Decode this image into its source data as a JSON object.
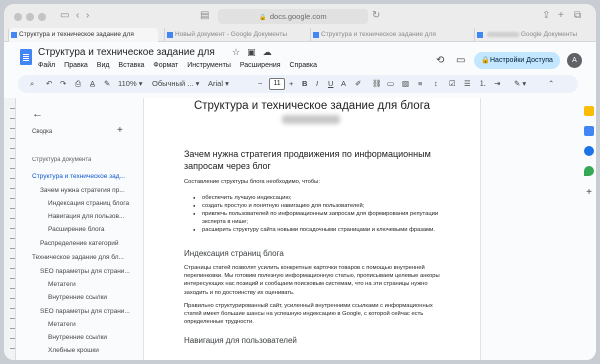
{
  "browser": {
    "address": "docs.google.com",
    "tabs": [
      {
        "label": "Структура и техническое задание для",
        "active": true
      },
      {
        "label": "Новый документ - Google Документы",
        "active": false
      },
      {
        "label": "Структура и техническое задание для",
        "active": false
      },
      {
        "label": "Google Документы",
        "active": false
      }
    ]
  },
  "doc": {
    "title": "Структура и техническое задание для",
    "menu": [
      "Файл",
      "Правка",
      "Вид",
      "Вставка",
      "Формат",
      "Инструменты",
      "Расширения",
      "Справка"
    ],
    "share_label": "Настройки Доступа",
    "avatar_letter": "A"
  },
  "toolbar": {
    "zoom": "110%",
    "style": "Обычный ...",
    "font": "Arial",
    "font_size": "11"
  },
  "outline": {
    "label": "Сводка",
    "heading": "Структура документа",
    "items": [
      {
        "text": "Структура и техническое зад...",
        "level": 0,
        "active": true
      },
      {
        "text": "Зачем нужна стратегия пр...",
        "level": 1,
        "active": false
      },
      {
        "text": "Индексация страниц блога",
        "level": 2,
        "active": false
      },
      {
        "text": "Навигация для пользов...",
        "level": 2,
        "active": false
      },
      {
        "text": "Расширение блога",
        "level": 2,
        "active": false
      },
      {
        "text": "Распределение категорий",
        "level": 1,
        "active": false
      },
      {
        "text": "Техническое задание для бл...",
        "level": 0,
        "active": false
      },
      {
        "text": "SEO параметры для страни...",
        "level": 1,
        "active": false
      },
      {
        "text": "Метатеги",
        "level": 2,
        "active": false
      },
      {
        "text": "Внутренние ссылки",
        "level": 2,
        "active": false
      },
      {
        "text": "SEO параметры для страни...",
        "level": 1,
        "active": false
      },
      {
        "text": "Метатеги",
        "level": 2,
        "active": false
      },
      {
        "text": "Внутренние ссылки",
        "level": 2,
        "active": false
      },
      {
        "text": "Хлебные крошки",
        "level": 2,
        "active": false
      }
    ]
  },
  "page": {
    "title": "Структура и техническое задание для блога",
    "h2_1": "Зачем нужна стратегия продвижения по информационным запросам через блог",
    "intro": "Составление структуры блога необходимо, чтобы:",
    "bullets": [
      "обеспечить лучшую индексацию;",
      "создать простую и понятную навигацию для пользователей;",
      "привлечь пользователей по информационным запросам для формирования репутации эксперта в нише;",
      "расширить структуру сайта новыми посадочными страницами и ключевыми фразами."
    ],
    "h3_1": "Индексация страниц блога",
    "para_1": "Страницы статей позволят усилить конкретные карточки товаров с помощью внутренней перелинковки. Мы готовим полезную информационную статью, прописываем целевые анкоры интересующих нас позиций и сообщаем поисковым системам, что на эти страницы нужно заходить и по достоинству их оценивать.",
    "para_2": "Правильно структурированный сайт, усиленный внутренними ссылками с информационных статей имеет большие шансы на успешную индексацию в Google, с которой сейчас есть определенные трудности.",
    "h3_2": "Навигация для пользователей"
  },
  "colors": {
    "accent": "#0b57d0",
    "share_bg": "#c2e7ff",
    "doc_blue": "#4285f4"
  }
}
